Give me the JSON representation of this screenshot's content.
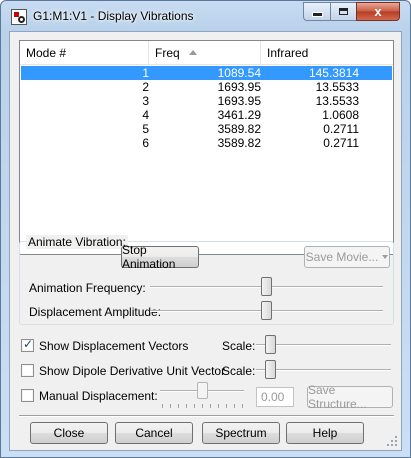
{
  "window": {
    "title": "G1:M1:V1 - Display Vibrations",
    "close_glyph": "x"
  },
  "table": {
    "columns": [
      "Mode #",
      "Freq",
      "Infrared"
    ],
    "sorted_column": "Freq",
    "rows": [
      {
        "mode": "1",
        "freq": "1089.54",
        "ir": "145.3814",
        "selected": true
      },
      {
        "mode": "2",
        "freq": "1693.95",
        "ir": "13.5533",
        "selected": false
      },
      {
        "mode": "3",
        "freq": "1693.95",
        "ir": "13.5533",
        "selected": false
      },
      {
        "mode": "4",
        "freq": "3461.29",
        "ir": "1.0608",
        "selected": false
      },
      {
        "mode": "5",
        "freq": "3589.82",
        "ir": "0.2711",
        "selected": false
      },
      {
        "mode": "6",
        "freq": "3589.82",
        "ir": "0.2711",
        "selected": false
      }
    ]
  },
  "animate": {
    "group_label": "Animate Vibration:",
    "stop_button": "Stop Animation",
    "save_movie_button": "Save Movie...",
    "frequency_label": "Animation Frequency:",
    "amplitude_label": "Displacement Amplitude:"
  },
  "options": {
    "show_displacement_label": "Show Displacement Vectors",
    "show_displacement_checked": true,
    "show_dipole_label": "Show Dipole Derivative Unit Vector",
    "show_dipole_checked": false,
    "scale_label": "Scale:",
    "manual_label": "Manual Displacement:",
    "manual_checked": false,
    "manual_value": "0.00",
    "save_structure_button": "Save Structure..."
  },
  "footer": {
    "close_button": "Close",
    "cancel_button": "Cancel",
    "spectrum_button": "Spectrum",
    "help_button": "Help"
  },
  "colors": {
    "selection": "#3399ff",
    "close_button": "#c75b44"
  }
}
